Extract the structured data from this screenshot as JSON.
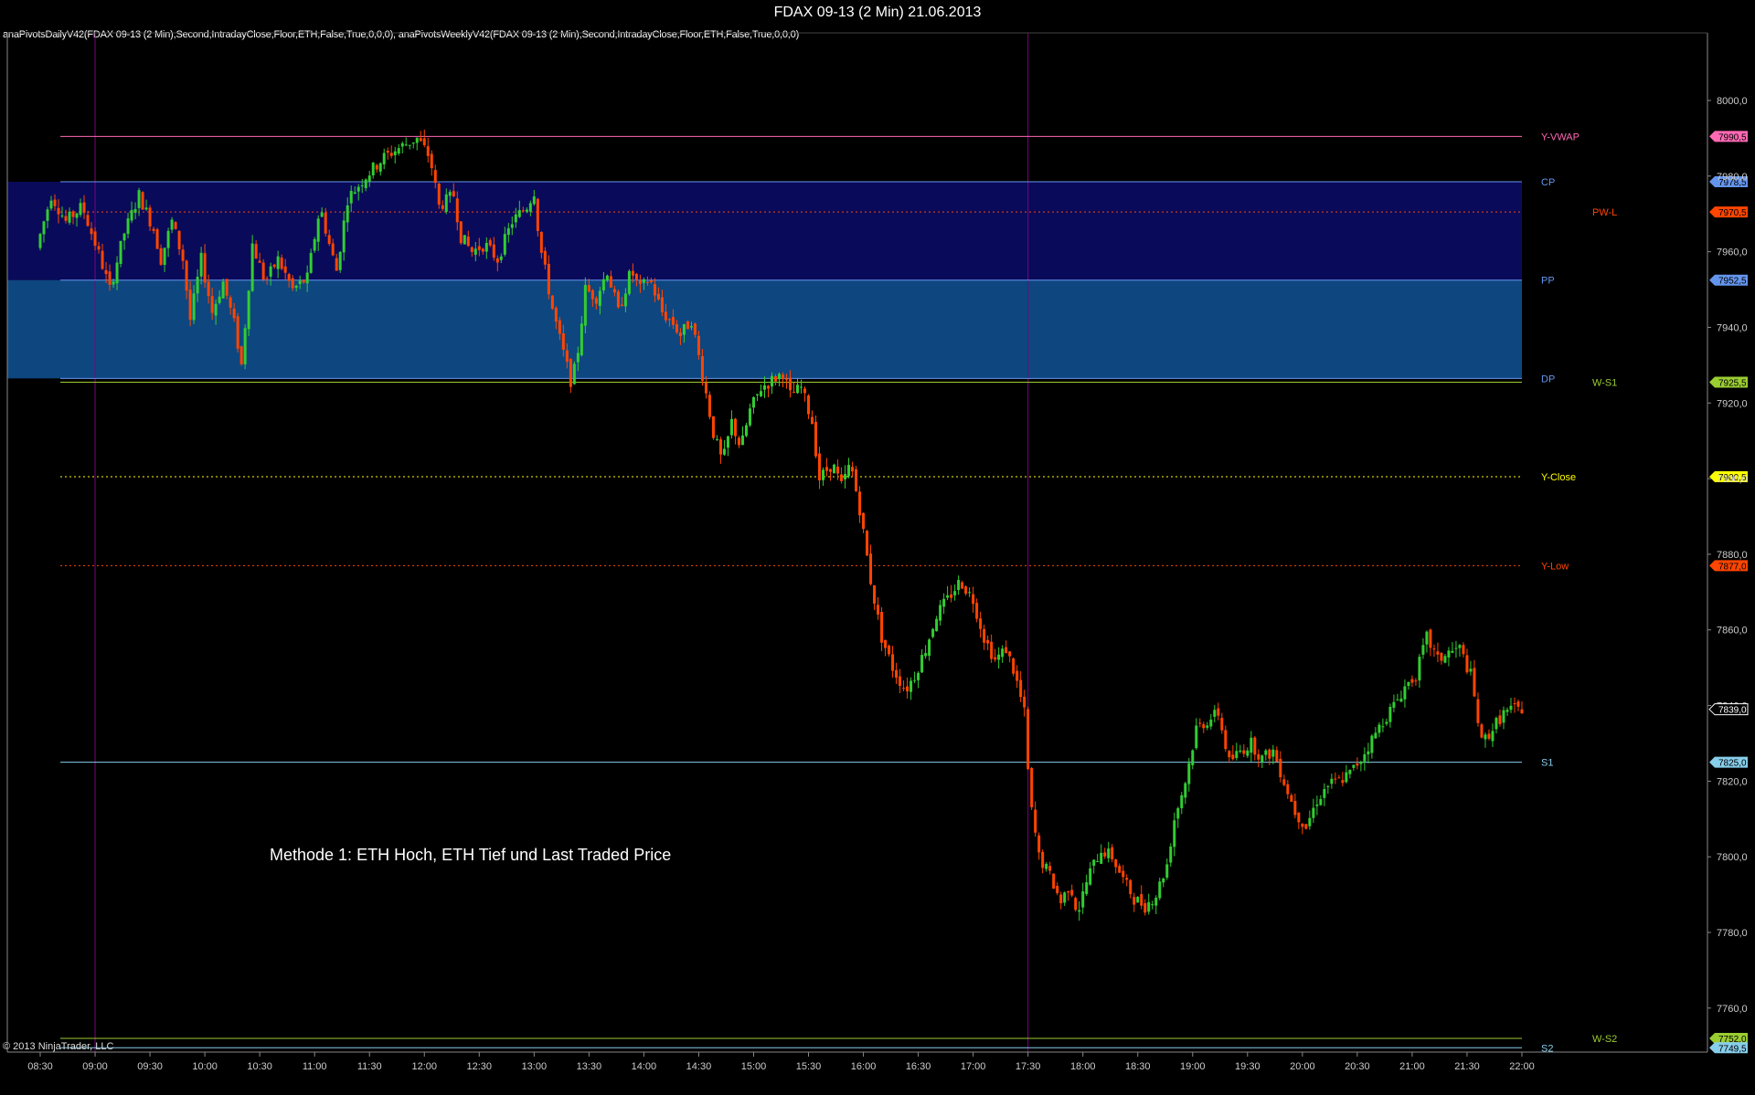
{
  "title": "FDAX 09-13 (2 Min)  21.06.2013",
  "indicators_label": "anaPivotsDailyV42(FDAX 09-13 (2 Min),Second,IntradayClose,Floor,ETH,False,True,0,0,0), anaPivotsWeeklyV42(FDAX 09-13 (2 Min),Second,IntradayClose,Floor,ETH,False,True,0,0,0)",
  "copyright": "© 2013 NinjaTrader, LLC",
  "annotation": "Methode 1: ETH Hoch, ETH Tief und Last Traded Price",
  "colors": {
    "background": "#000000",
    "candle_up": "#32cd32",
    "candle_down": "#ff4500",
    "session_line": "#800080",
    "zone_upper": "#0a0a5a",
    "zone_lower": "#0e4680"
  },
  "chart_data": {
    "type": "candlestick",
    "ylim": [
      7743,
      8022
    ],
    "y_ticks": [
      "8000,0",
      "7980,0",
      "7960,0",
      "7940,0",
      "7920,0",
      "7900,0",
      "7880,0",
      "7860,0",
      "7840,0",
      "7820,0",
      "7800,0",
      "7780,0",
      "7760,0"
    ],
    "x_ticks": [
      "08:30",
      "09:00",
      "09:30",
      "10:00",
      "10:30",
      "11:00",
      "11:30",
      "12:00",
      "12:30",
      "13:00",
      "13:30",
      "14:00",
      "14:30",
      "15:00",
      "15:30",
      "16:00",
      "16:30",
      "17:00",
      "17:30",
      "18:00",
      "18:30",
      "19:00",
      "19:30",
      "20:00",
      "20:30",
      "21:00",
      "21:30",
      "22:00"
    ],
    "x_range": [
      "08:30",
      "22:00"
    ],
    "session_lines": [
      "09:00",
      "17:30"
    ],
    "zones": [
      {
        "from": 7952.5,
        "to": 7978.5,
        "color": "upper",
        "x_start": "08:30",
        "x_end": "22:00"
      },
      {
        "from": 7926.5,
        "to": 7952.5,
        "color": "lower",
        "x_start": "08:30",
        "x_end": "22:00"
      }
    ],
    "levels": [
      {
        "label": "Y-VWAP",
        "value": 7990.5,
        "price": "7990,5",
        "color": "#ff69b4",
        "style": "solid",
        "label_col": 1
      },
      {
        "label": "CP",
        "value": 7978.5,
        "price": "7978,5",
        "color": "#6495ed",
        "style": "solid",
        "label_col": 1
      },
      {
        "label": "PW-L",
        "value": 7970.5,
        "price": "7970,5",
        "color": "#ff4500",
        "style": "dotted",
        "label_col": 2
      },
      {
        "label": "PP",
        "value": 7952.5,
        "price": "7952,5",
        "color": "#6495ed",
        "style": "solid",
        "label_col": 1
      },
      {
        "label": "DP",
        "value": 7926.5,
        "price": "",
        "color": "#6495ed",
        "style": "solid",
        "label_col": 1
      },
      {
        "label": "W-S1",
        "value": 7925.5,
        "price": "7925,5",
        "color": "#9acd32",
        "style": "solid",
        "label_col": 2
      },
      {
        "label": "Y-Close",
        "value": 7900.5,
        "price": "7900,5",
        "color": "#ffff00",
        "style": "dotted",
        "label_col": 1
      },
      {
        "label": "Y-Low",
        "value": 7877.0,
        "price": "7877,0",
        "color": "#ff4500",
        "style": "dotted",
        "label_col": 1
      },
      {
        "label": "S1",
        "value": 7825.0,
        "price": "7825,0",
        "color": "#87ceeb",
        "style": "solid",
        "label_col": 1
      },
      {
        "label": "W-S2",
        "value": 7752.0,
        "price": "7752,0",
        "color": "#9acd32",
        "style": "solid",
        "label_col": 2
      },
      {
        "label": "S2",
        "value": 7749.5,
        "price": "7749,5",
        "color": "#87ceeb",
        "style": "solid",
        "label_col": 1
      }
    ],
    "last_price": {
      "value": 7839.0,
      "price": "7839,0"
    },
    "path": [
      [
        "08:30",
        7961
      ],
      [
        "08:38",
        7975
      ],
      [
        "08:46",
        7968
      ],
      [
        "08:55",
        7972
      ],
      [
        "09:05",
        7958
      ],
      [
        "09:10",
        7950
      ],
      [
        "09:18",
        7965
      ],
      [
        "09:26",
        7975
      ],
      [
        "09:34",
        7966
      ],
      [
        "09:38",
        7958
      ],
      [
        "09:44",
        7968
      ],
      [
        "09:50",
        7958
      ],
      [
        "09:54",
        7942
      ],
      [
        "10:00",
        7958
      ],
      [
        "10:06",
        7944
      ],
      [
        "10:12",
        7952
      ],
      [
        "10:18",
        7941
      ],
      [
        "10:22",
        7930
      ],
      [
        "10:28",
        7962
      ],
      [
        "10:35",
        7952
      ],
      [
        "10:42",
        7958
      ],
      [
        "10:50",
        7950
      ],
      [
        "10:58",
        7953
      ],
      [
        "11:05",
        7972
      ],
      [
        "11:10",
        7962
      ],
      [
        "11:14",
        7955
      ],
      [
        "11:20",
        7974
      ],
      [
        "11:30",
        7980
      ],
      [
        "11:40",
        7985
      ],
      [
        "11:50",
        7988
      ],
      [
        "11:58",
        7990
      ],
      [
        "12:05",
        7985
      ],
      [
        "12:10",
        7972
      ],
      [
        "12:18",
        7975
      ],
      [
        "12:22",
        7964
      ],
      [
        "12:28",
        7960
      ],
      [
        "12:35",
        7962
      ],
      [
        "12:42",
        7958
      ],
      [
        "12:50",
        7968
      ],
      [
        "12:58",
        7972
      ],
      [
        "13:02",
        7976
      ],
      [
        "13:05",
        7962
      ],
      [
        "13:08",
        7955
      ],
      [
        "13:12",
        7945
      ],
      [
        "13:17",
        7935
      ],
      [
        "13:22",
        7926
      ],
      [
        "13:25",
        7930
      ],
      [
        "13:30",
        7950
      ],
      [
        "13:36",
        7948
      ],
      [
        "13:42",
        7955
      ],
      [
        "13:48",
        7944
      ],
      [
        "13:55",
        7955
      ],
      [
        "14:00",
        7950
      ],
      [
        "14:05",
        7953
      ],
      [
        "14:12",
        7944
      ],
      [
        "14:18",
        7941
      ],
      [
        "14:22",
        7938
      ],
      [
        "14:28",
        7942
      ],
      [
        "14:35",
        7925
      ],
      [
        "14:40",
        7912
      ],
      [
        "14:45",
        7904
      ],
      [
        "14:50",
        7915
      ],
      [
        "14:55",
        7908
      ],
      [
        "15:00",
        7918
      ],
      [
        "15:06",
        7924
      ],
      [
        "15:12",
        7926
      ],
      [
        "15:18",
        7928
      ],
      [
        "15:22",
        7922
      ],
      [
        "15:28",
        7924
      ],
      [
        "15:34",
        7915
      ],
      [
        "15:38",
        7900
      ],
      [
        "15:45",
        7904
      ],
      [
        "15:50",
        7898
      ],
      [
        "15:55",
        7904
      ],
      [
        "16:00",
        7892
      ],
      [
        "16:06",
        7873
      ],
      [
        "16:12",
        7858
      ],
      [
        "16:18",
        7850
      ],
      [
        "16:25",
        7844
      ],
      [
        "16:30",
        7848
      ],
      [
        "16:36",
        7855
      ],
      [
        "16:42",
        7864
      ],
      [
        "16:48",
        7868
      ],
      [
        "16:55",
        7873
      ],
      [
        "17:02",
        7868
      ],
      [
        "17:08",
        7858
      ],
      [
        "17:14",
        7852
      ],
      [
        "17:20",
        7855
      ],
      [
        "17:25",
        7848
      ],
      [
        "17:30",
        7838
      ],
      [
        "17:33",
        7815
      ],
      [
        "17:38",
        7800
      ],
      [
        "17:44",
        7795
      ],
      [
        "17:50",
        7788
      ],
      [
        "17:55",
        7793
      ],
      [
        "17:59",
        7785
      ],
      [
        "18:05",
        7795
      ],
      [
        "18:12",
        7802
      ],
      [
        "18:18",
        7800
      ],
      [
        "18:24",
        7794
      ],
      [
        "18:30",
        7789
      ],
      [
        "18:36",
        7787
      ],
      [
        "18:42",
        7790
      ],
      [
        "18:48",
        7798
      ],
      [
        "18:52",
        7810
      ],
      [
        "18:58",
        7820
      ],
      [
        "19:04",
        7834
      ],
      [
        "19:10",
        7836
      ],
      [
        "19:16",
        7838
      ],
      [
        "19:22",
        7825
      ],
      [
        "19:28",
        7828
      ],
      [
        "19:34",
        7830
      ],
      [
        "19:40",
        7826
      ],
      [
        "19:46",
        7828
      ],
      [
        "19:52",
        7820
      ],
      [
        "19:58",
        7812
      ],
      [
        "20:04",
        7808
      ],
      [
        "20:10",
        7815
      ],
      [
        "20:16",
        7819
      ],
      [
        "20:22",
        7820
      ],
      [
        "20:28",
        7822
      ],
      [
        "20:34",
        7826
      ],
      [
        "20:40",
        7831
      ],
      [
        "20:46",
        7836
      ],
      [
        "20:52",
        7840
      ],
      [
        "20:58",
        7845
      ],
      [
        "21:04",
        7848
      ],
      [
        "21:10",
        7858
      ],
      [
        "21:16",
        7852
      ],
      [
        "21:22",
        7854
      ],
      [
        "21:28",
        7855
      ],
      [
        "21:34",
        7848
      ],
      [
        "21:40",
        7830
      ],
      [
        "21:46",
        7834
      ],
      [
        "21:52",
        7838
      ],
      [
        "21:58",
        7839
      ]
    ]
  }
}
